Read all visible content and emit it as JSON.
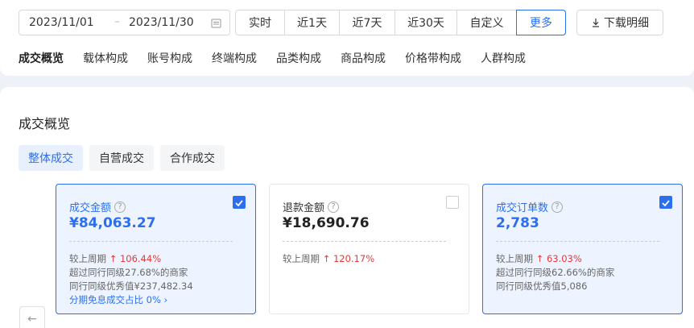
{
  "date_range": {
    "start": "2023/11/01",
    "separator": "–",
    "end": "2023/11/30"
  },
  "period_buttons": [
    {
      "label": "实时"
    },
    {
      "label": "近1天"
    },
    {
      "label": "近7天"
    },
    {
      "label": "近30天"
    },
    {
      "label": "自定义"
    },
    {
      "label": "更多"
    }
  ],
  "download_label": "下载明细",
  "nav_tabs": [
    "成交概览",
    "载体构成",
    "账号构成",
    "终端构成",
    "品类构成",
    "商品构成",
    "价格带构成",
    "人群构成"
  ],
  "section_title": "成交概览",
  "sub_tabs": [
    "整体成交",
    "自营成交",
    "合作成交"
  ],
  "cards": [
    {
      "label": "成交金额",
      "value": "¥84,063.27",
      "compare_label": "较上周期",
      "compare_value": "106.44%",
      "line2": "超过同行同级27.68%的商家",
      "line3": "同行同级优秀值¥237,482.34",
      "line4": "分期免息成交占比 0% ›",
      "checked": true
    },
    {
      "label": "退款金额",
      "value": "¥18,690.76",
      "compare_label": "较上周期",
      "compare_value": "120.17%",
      "checked": false
    },
    {
      "label": "成交订单数",
      "value": "2,783",
      "compare_label": "较上周期",
      "compare_value": "63.03%",
      "line2": "超过同行同级62.66%的商家",
      "line3": "同行同级优秀值5,086",
      "checked": true
    }
  ],
  "colors": {
    "accent": "#2b6ff0",
    "up": "#e53935"
  }
}
